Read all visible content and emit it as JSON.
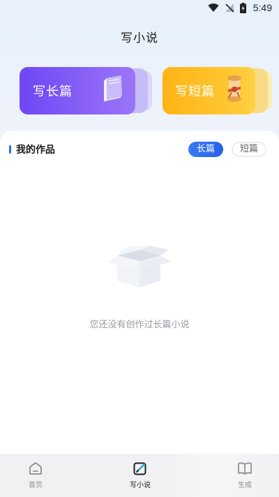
{
  "status_bar": {
    "time": "5:49",
    "icons": [
      "wifi-icon",
      "no-signal-icon",
      "battery-charging-icon"
    ]
  },
  "header": {
    "title": "写小说"
  },
  "cards": {
    "long": {
      "label": "写长篇",
      "icon": "book-icon",
      "color": "#7b52f6"
    },
    "short": {
      "label": "写短篇",
      "icon": "scroll-icon",
      "color": "#ffbd22"
    }
  },
  "works": {
    "title": "我的作品",
    "tabs": [
      {
        "label": "长篇",
        "active": true
      },
      {
        "label": "短篇",
        "active": false
      }
    ],
    "empty_icon": "empty-box-icon",
    "empty_text": "您还没有创作过长篇小说"
  },
  "bottom_nav": {
    "items": [
      {
        "label": "首页",
        "icon": "home-icon",
        "active": false
      },
      {
        "label": "写小说",
        "icon": "write-icon",
        "active": true
      },
      {
        "label": "生成",
        "icon": "open-book-icon",
        "active": false
      }
    ]
  },
  "colors": {
    "accent": "#2b6bf3",
    "long_card": "#7b52f6",
    "short_card": "#ffbd22"
  }
}
